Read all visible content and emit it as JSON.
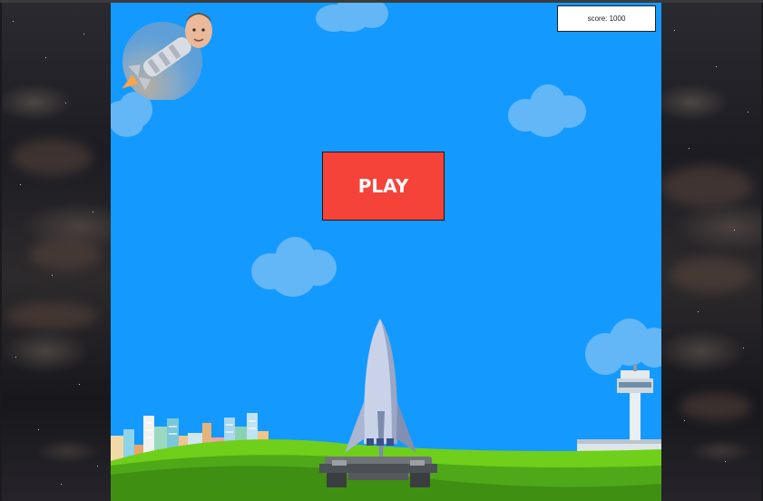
{
  "hud": {
    "score_text": "score: 1000"
  },
  "menu": {
    "play_label": "PLAY"
  },
  "colors": {
    "sky": "#1499ff",
    "cloud": "#63b7f6",
    "play_button": "#f5433a",
    "grass_light": "#6fcf1a",
    "grass_dark": "#3f8f12"
  },
  "icons": {
    "player_avatar": "rocket-rider-avatar-icon",
    "rocket": "rocket-icon",
    "launch_pad": "launch-pad-icon",
    "control_tower": "control-tower-icon"
  }
}
